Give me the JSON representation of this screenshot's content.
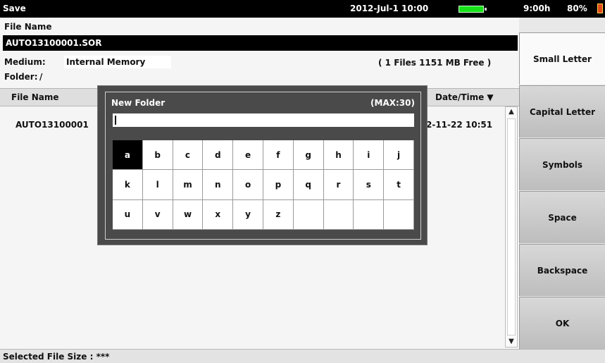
{
  "topbar": {
    "title": "Save",
    "datetime": "2012-Jul-1 10:00",
    "battery_time": "9:00h",
    "battery_percent": "80%",
    "battery_color": "#18e018"
  },
  "form": {
    "filename_label": "File Name",
    "filename_value": "AUTO13100001.SOR",
    "medium_label": "Medium:",
    "medium_value": "Internal Memory",
    "files_info": "( 1 Files   1151 MB Free )",
    "folder_label": "Folder:",
    "folder_value": "/"
  },
  "list": {
    "col_filename": "File Name",
    "col_datetime": "Date/Time ▼",
    "rows": [
      {
        "name": "AUTO13100001",
        "date": "2-11-22 10:51"
      }
    ]
  },
  "status": {
    "text": "Selected File Size : ***"
  },
  "softkeys": {
    "small": "Small Letter",
    "capital": "Capital Letter",
    "symbols": "Symbols",
    "space": "Space",
    "backspace": "Backspace",
    "ok": "OK"
  },
  "dialog": {
    "title": "New Folder",
    "max": "(MAX:30)",
    "input_value": "",
    "selected_key": "a",
    "keys": [
      "a",
      "b",
      "c",
      "d",
      "e",
      "f",
      "g",
      "h",
      "i",
      "j",
      "k",
      "l",
      "m",
      "n",
      "o",
      "p",
      "q",
      "r",
      "s",
      "t",
      "u",
      "v",
      "w",
      "x",
      "y",
      "z",
      "",
      "",
      "",
      ""
    ]
  }
}
